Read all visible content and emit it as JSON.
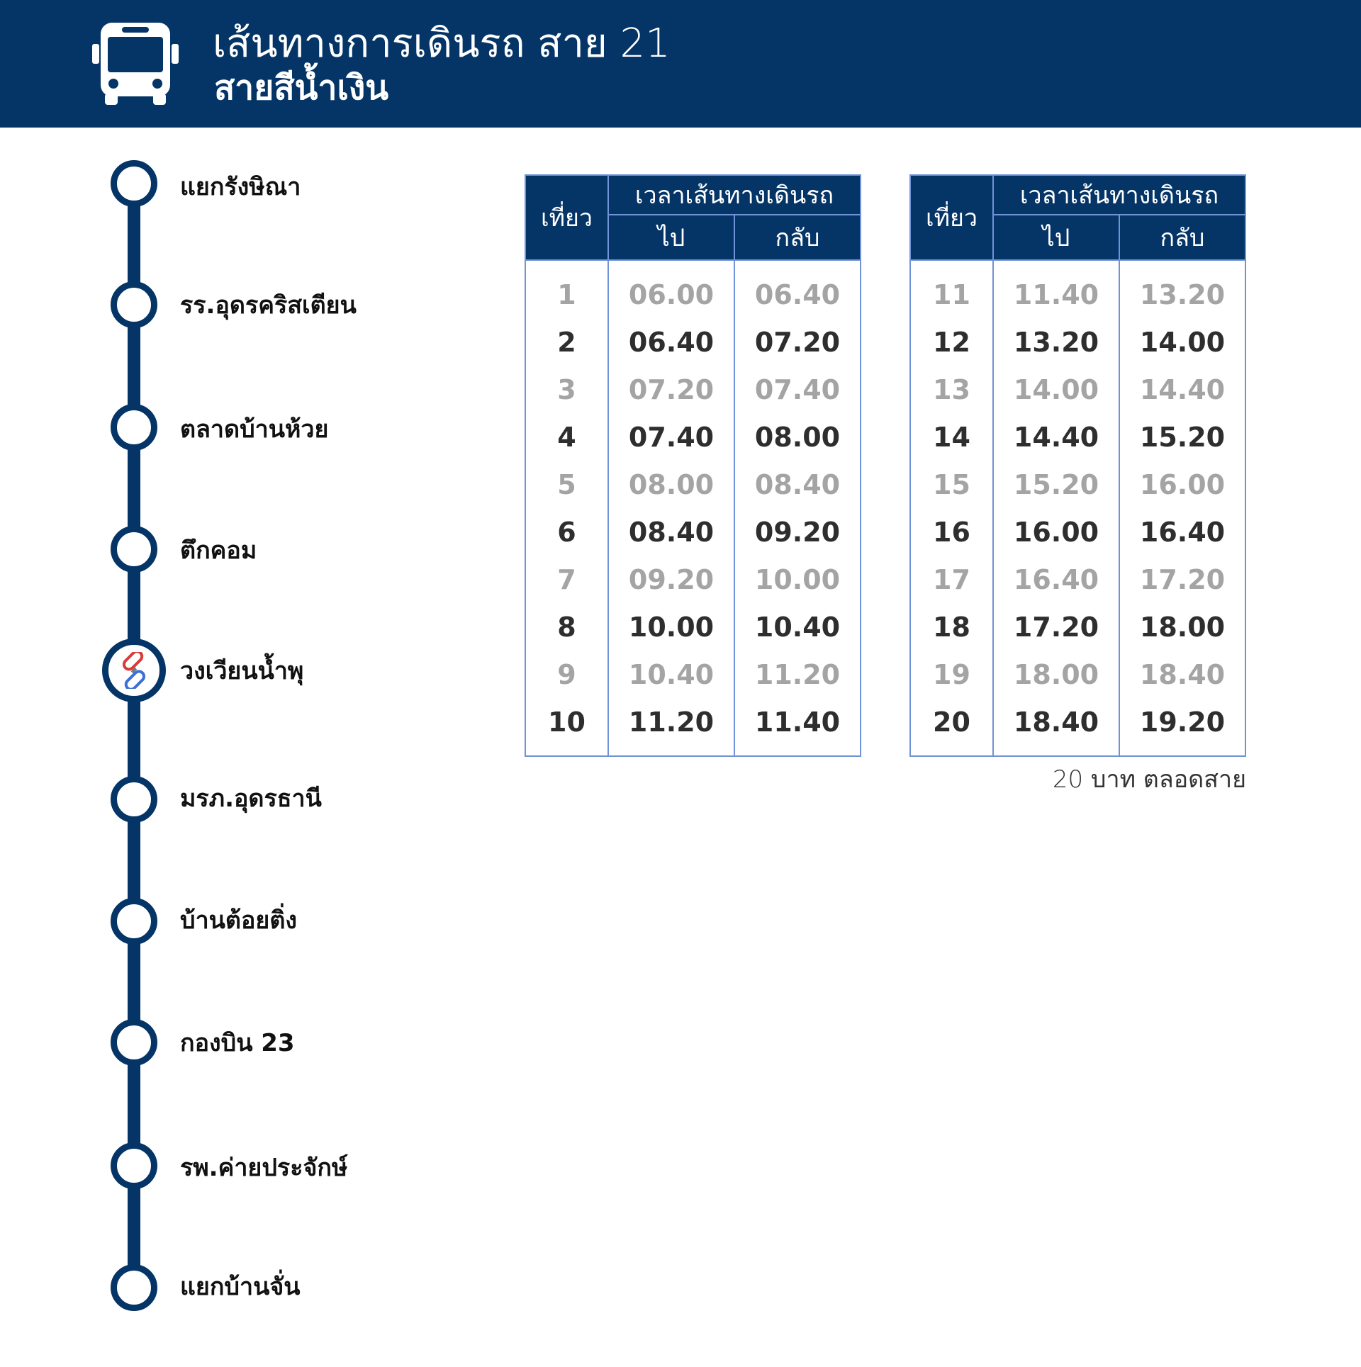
{
  "header": {
    "title": "เส้นทางการเดินรถ สาย 21",
    "subtitle": "สายสีน้ำเงิน",
    "icon": "bus-icon",
    "background_color": "#043566"
  },
  "route": {
    "line_color": "#043566",
    "stops": [
      {
        "name": "แยกรังษิณา",
        "transfer": false
      },
      {
        "name": "รร.อุดรคริสเตียน",
        "transfer": false
      },
      {
        "name": "ตลาดบ้านห้วย",
        "transfer": false
      },
      {
        "name": "ตึกคอม",
        "transfer": false
      },
      {
        "name": "วงเวียนน้ำพุ",
        "transfer": true,
        "icon": "link-icon"
      },
      {
        "name": "มรภ.อุดรธานี",
        "transfer": false
      },
      {
        "name": "บ้านต้อยติ่ง",
        "transfer": false
      },
      {
        "name": "กองบิน 23",
        "transfer": false
      },
      {
        "name": "รพ.ค่ายประจักษ์",
        "transfer": false
      },
      {
        "name": "แยกบ้านจั่น",
        "transfer": false
      }
    ]
  },
  "timetable": {
    "header_trip": "เที่ยว",
    "header_group": "เวลาเส้นทางเดินรถ",
    "header_out": "ไป",
    "header_back": "กลับ",
    "tables": [
      {
        "rows": [
          {
            "trip": "1",
            "out": "06.00",
            "back": "06.40"
          },
          {
            "trip": "2",
            "out": "06.40",
            "back": "07.20"
          },
          {
            "trip": "3",
            "out": "07.20",
            "back": "07.40"
          },
          {
            "trip": "4",
            "out": "07.40",
            "back": "08.00"
          },
          {
            "trip": "5",
            "out": "08.00",
            "back": "08.40"
          },
          {
            "trip": "6",
            "out": "08.40",
            "back": "09.20"
          },
          {
            "trip": "7",
            "out": "09.20",
            "back": "10.00"
          },
          {
            "trip": "8",
            "out": "10.00",
            "back": "10.40"
          },
          {
            "trip": "9",
            "out": "10.40",
            "back": "11.20"
          },
          {
            "trip": "10",
            "out": "11.20",
            "back": "11.40"
          }
        ]
      },
      {
        "rows": [
          {
            "trip": "11",
            "out": "11.40",
            "back": "13.20"
          },
          {
            "trip": "12",
            "out": "13.20",
            "back": "14.00"
          },
          {
            "trip": "13",
            "out": "14.00",
            "back": "14.40"
          },
          {
            "trip": "14",
            "out": "14.40",
            "back": "15.20"
          },
          {
            "trip": "15",
            "out": "15.20",
            "back": "16.00"
          },
          {
            "trip": "16",
            "out": "16.00",
            "back": "16.40"
          },
          {
            "trip": "17",
            "out": "16.40",
            "back": "17.20"
          },
          {
            "trip": "18",
            "out": "17.20",
            "back": "18.00"
          },
          {
            "trip": "19",
            "out": "18.00",
            "back": "18.40"
          },
          {
            "trip": "20",
            "out": "18.40",
            "back": "19.20"
          }
        ]
      }
    ]
  },
  "fare": "20 บาท ตลอดสาย"
}
